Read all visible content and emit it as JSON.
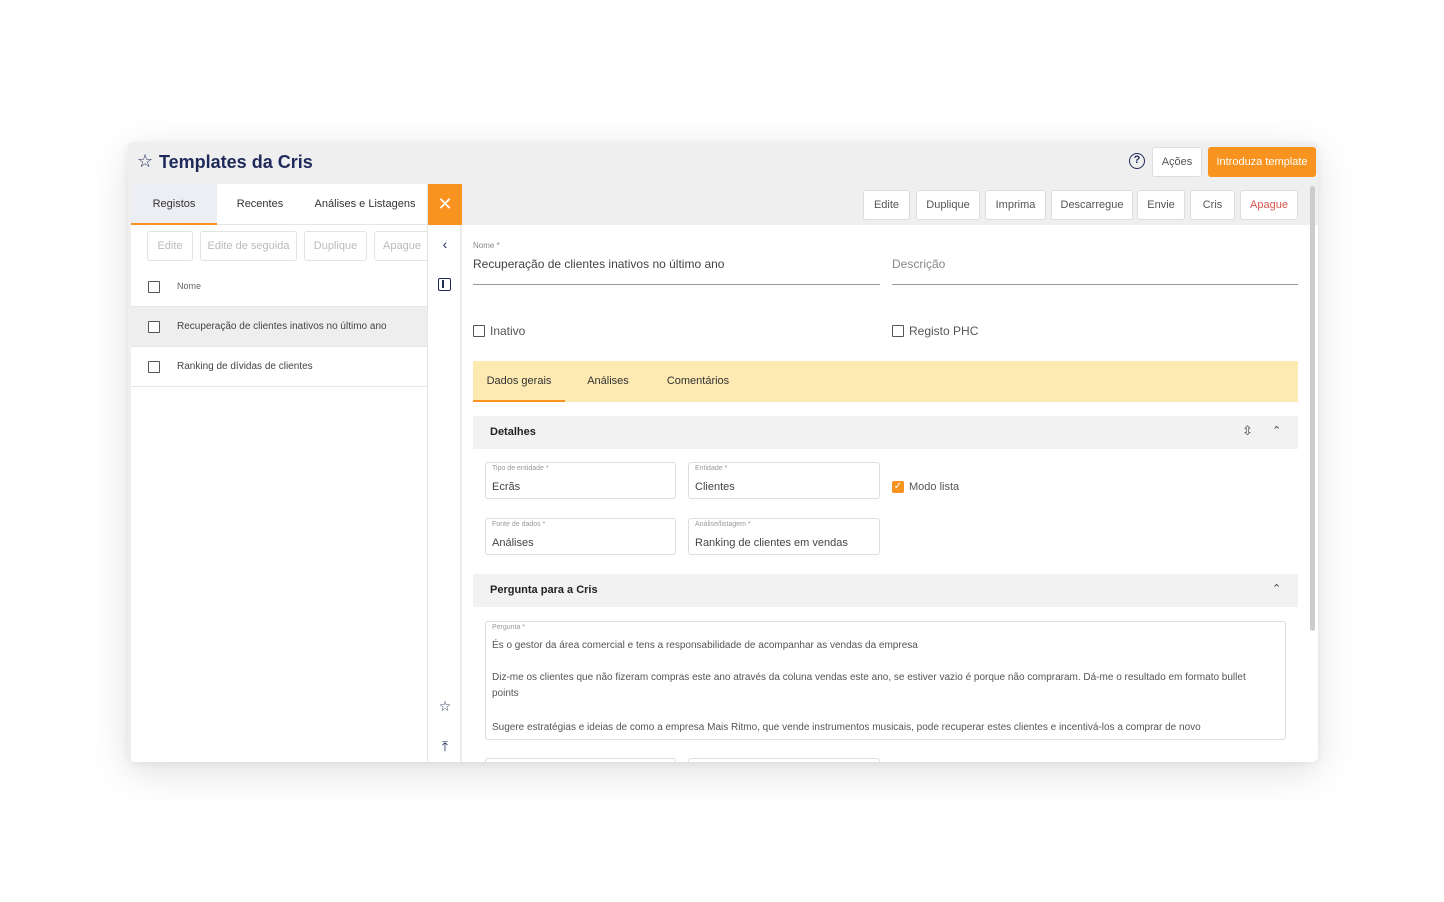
{
  "window": {
    "title": "Templates da Cris",
    "actions_label": "Ações",
    "primary_label": "Introduza template"
  },
  "left": {
    "tabs": [
      "Registos",
      "Recentes",
      "Análises e Listagens"
    ],
    "toolbar": [
      "Edite",
      "Edite de seguida",
      "Duplique",
      "Apague"
    ],
    "column_header": "Nome",
    "rows": [
      "Recuperação de clientes inativos no último ano",
      "Ranking de dívidas de clientes"
    ]
  },
  "right": {
    "toolbar": [
      "Edite",
      "Duplique",
      "Imprima",
      "Descarregue",
      "Envie",
      "Cris",
      "Apague"
    ],
    "nome_label": "Nome *",
    "nome_value": "Recuperação de clientes inativos no último ano",
    "descricao_placeholder": "Descrição",
    "inativo_label": "Inativo",
    "registo_phc_label": "Registo PHC",
    "sub_tabs": [
      "Dados gerais",
      "Análises",
      "Comentários"
    ],
    "detalhes_title": "Detalhes",
    "tipo_entidade_label": "Tipo de entidade *",
    "tipo_entidade_value": "Ecrãs",
    "entidade_label": "Entidade *",
    "entidade_value": "Clientes",
    "modo_lista_label": "Modo lista",
    "fonte_dados_label": "Fonte de dados *",
    "fonte_dados_value": "Análises",
    "analise_label": "Análise/listagem *",
    "analise_value": "Ranking de clientes em vendas",
    "pergunta_title": "Pergunta para a Cris",
    "pergunta_label": "Pergunta *",
    "pergunta_lines": [
      "És o gestor da área comercial e tens a responsabilidade de acompanhar as vendas da empresa",
      "Diz-me os clientes que não fizeram compras este ano através da coluna vendas este ano, se estiver vazio é porque não compraram. Dá-me o resultado em formato bullet points",
      "Sugere estratégias e ideias de como a empresa Mais Ritmo, que vende instrumentos musicais, pode recuperar estes clientes e incentivá-los a comprar de novo"
    ]
  }
}
